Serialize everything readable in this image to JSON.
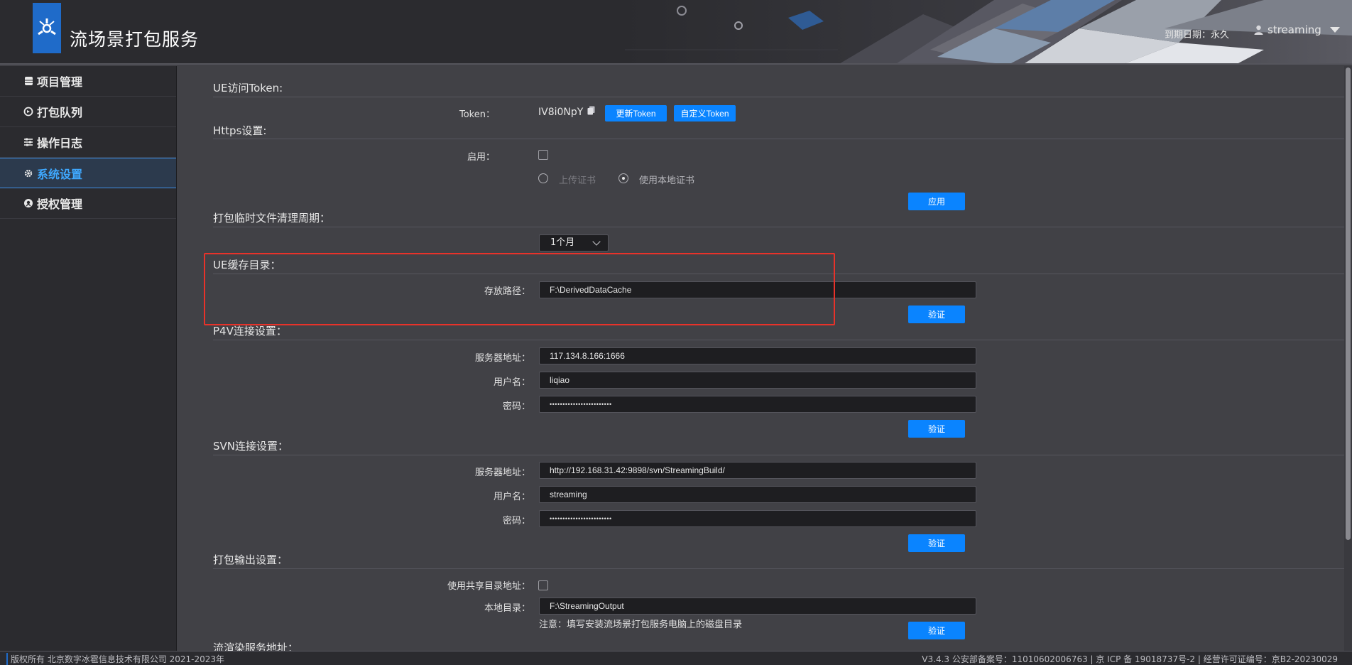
{
  "header": {
    "app_title": "流场景打包服务",
    "expire_label": "到期日期：永久",
    "username": "streaming"
  },
  "sidebar": {
    "items": [
      {
        "label": "项目管理",
        "icon": "database-icon",
        "active": false
      },
      {
        "label": "打包队列",
        "icon": "queue-icon",
        "active": false
      },
      {
        "label": "操作日志",
        "icon": "sliders-icon",
        "active": false
      },
      {
        "label": "系统设置",
        "icon": "gear-icon",
        "active": true
      },
      {
        "label": "授权管理",
        "icon": "license-icon",
        "active": false
      }
    ]
  },
  "token": {
    "section_title": "UE访问Token:",
    "label": "Token：",
    "value": "IV8i0NpY",
    "refresh_btn": "更新Token",
    "custom_btn": "自定义Token"
  },
  "https": {
    "section_title": "Https设置:",
    "enable_label": "启用：",
    "option_upload": "上传证书",
    "option_local": "使用本地证书",
    "apply_btn": "应用"
  },
  "cleanup": {
    "section_title": "打包临时文件清理周期：",
    "selected": "1个月"
  },
  "ue_cache": {
    "section_title": "UE缓存目录：",
    "path_label": "存放路径：",
    "path_value": "F:\\DerivedDataCache",
    "verify_btn": "验证"
  },
  "p4v": {
    "section_title": "P4V连接设置：",
    "server_label": "服务器地址：",
    "server_value": "117.134.8.166:1666",
    "user_label": "用户名：",
    "user_value": "liqiao",
    "password_label": "密码：",
    "password_value": "••••••••••••••••••••••••",
    "verify_btn": "验证"
  },
  "svn": {
    "section_title": "SVN连接设置：",
    "server_label": "服务器地址：",
    "server_value": "http://192.168.31.42:9898/svn/StreamingBuild/",
    "user_label": "用户名：",
    "user_value": "streaming",
    "password_label": "密码：",
    "password_value": "••••••••••••••••••••••••",
    "verify_btn": "验证"
  },
  "output": {
    "section_title": "打包输出设置：",
    "shared_label": "使用共享目录地址：",
    "local_label": "本地目录：",
    "local_value": "F:\\StreamingOutput",
    "note": "注意：填写安装流场景打包服务电脑上的磁盘目录",
    "verify_btn": "验证"
  },
  "render": {
    "section_title": "流渲染服务地址："
  },
  "footer": {
    "copyright": "版权所有 北京数字冰雹信息技术有限公司 2021-2023年",
    "license": "V3.4.3 公安部备案号：11010602006763 | 京 ICP 备 19018737号-2 | 经营许可证编号：京B2-20230029"
  },
  "colors": {
    "accent": "#0a84ff",
    "highlight_box": "#e8322a",
    "active_nav": "#3fa9ff"
  }
}
